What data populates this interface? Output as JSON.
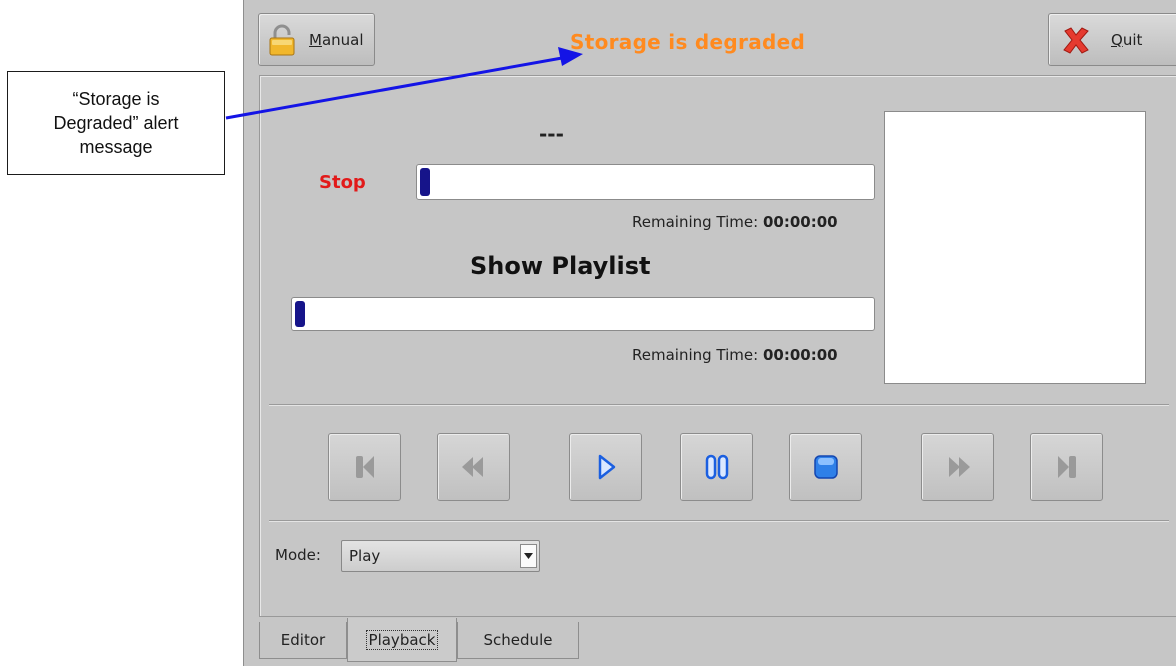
{
  "annotation": {
    "callout_text": "“Storage is\nDegraded” alert\nmessage"
  },
  "toolbar": {
    "manual_label": "Manual",
    "manual_accel": "M",
    "manual_rest": "anual",
    "manual_icon": "padlock-open-icon",
    "quit_label": "Quit",
    "quit_accel": "Q",
    "quit_rest": "uit",
    "quit_icon": "red-x-icon",
    "status_message": "Storage is degraded",
    "status_color": "#ff8a1f"
  },
  "playback": {
    "current_title": "---",
    "state": "Stop",
    "state_color": "#e21a1a",
    "clip_progress": 0,
    "clip_remaining_label": "Remaining Time:",
    "clip_remaining_value": "00:00:00",
    "playlist_title": "Show Playlist",
    "playlist_progress": 0,
    "playlist_remaining_label": "Remaining Time:",
    "playlist_remaining_value": "00:00:00",
    "progress_color": "#16148a"
  },
  "transport": [
    {
      "name": "skip-to-start",
      "icon": "skip-back-icon",
      "enabled": false
    },
    {
      "name": "rewind",
      "icon": "rewind-icon",
      "enabled": false
    },
    {
      "name": "play",
      "icon": "play-icon",
      "enabled": true
    },
    {
      "name": "pause",
      "icon": "pause-icon",
      "enabled": true
    },
    {
      "name": "stop",
      "icon": "stop-icon",
      "enabled": true
    },
    {
      "name": "fast-forward",
      "icon": "fast-forward-icon",
      "enabled": false
    },
    {
      "name": "skip-to-end",
      "icon": "skip-forward-icon",
      "enabled": false
    }
  ],
  "mode": {
    "label": "Mode:",
    "selected": "Play"
  },
  "tabs": [
    {
      "label": "Editor",
      "active": false
    },
    {
      "label": "Playback",
      "active": true
    },
    {
      "label": "Schedule",
      "active": false
    }
  ]
}
